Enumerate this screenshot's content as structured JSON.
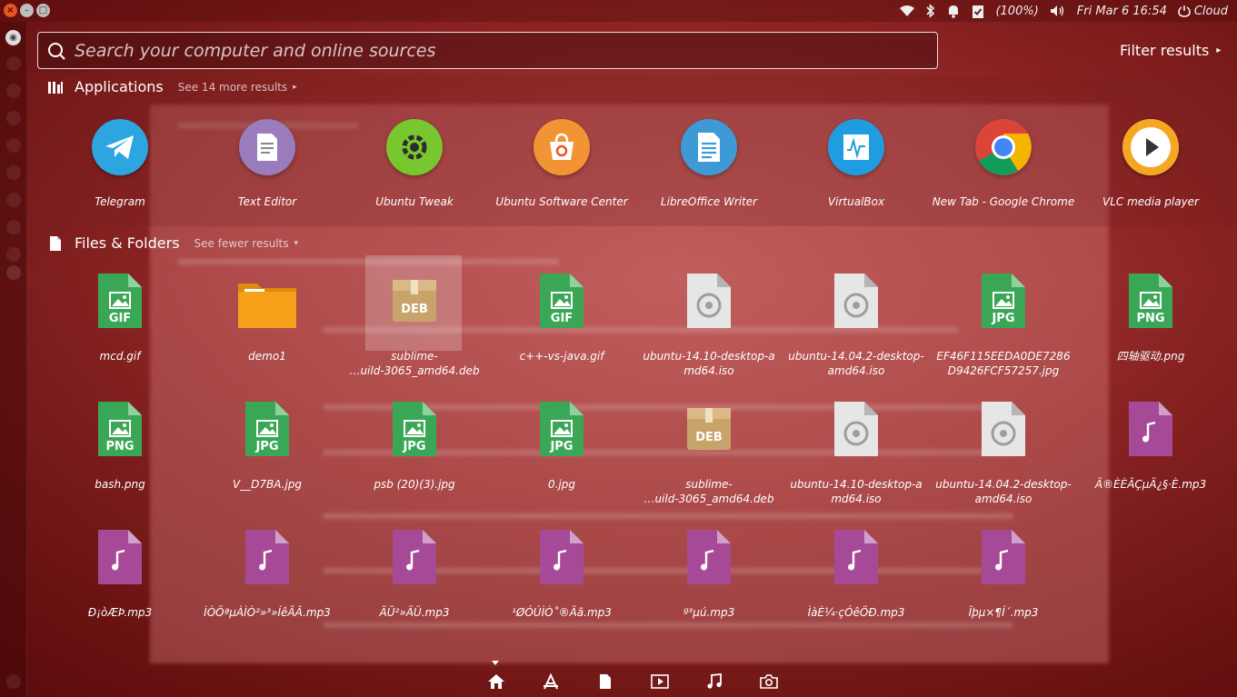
{
  "top_panel": {
    "battery": "(100%)",
    "datetime": "Fri Mar  6 16:54",
    "user": "Cloud"
  },
  "search": {
    "placeholder": "Search your computer and online sources",
    "value": ""
  },
  "filter": {
    "label": "Filter results"
  },
  "applications": {
    "title": "Applications",
    "more": "See 14 more results",
    "items": [
      {
        "label": "Telegram",
        "icon": "telegram-icon",
        "color": "#2ca5e0"
      },
      {
        "label": "Text Editor",
        "icon": "text-editor-icon",
        "color": "#9a7bbb"
      },
      {
        "label": "Ubuntu Tweak",
        "icon": "ubuntu-tweak-icon",
        "color": "#79c72f"
      },
      {
        "label": "Ubuntu Software Center",
        "icon": "software-center-icon",
        "color": "#f29434"
      },
      {
        "label": "LibreOffice Writer",
        "icon": "libreoffice-writer-icon",
        "color": "#3d9ad6"
      },
      {
        "label": "VirtualBox",
        "icon": "virtualbox-icon",
        "color": "#1f9de0"
      },
      {
        "label": "New Tab - Google Chrome",
        "icon": "chrome-icon",
        "color": "#4a8af4"
      },
      {
        "label": "VLC media player",
        "icon": "vlc-icon",
        "color": "#f5a623"
      }
    ]
  },
  "files": {
    "title": "Files & Folders",
    "more": "See fewer results",
    "items": [
      {
        "label": "mcd.gif",
        "type": "GIF",
        "kind": "image"
      },
      {
        "label": "demo1",
        "type": "",
        "kind": "folder"
      },
      {
        "label": "sublime-\n…uild-3065_amd64.deb",
        "type": "DEB",
        "kind": "deb"
      },
      {
        "label": "c++-vs-java.gif",
        "type": "GIF",
        "kind": "image"
      },
      {
        "label": "ubuntu-14.10-desktop-amd64.iso",
        "type": "",
        "kind": "iso"
      },
      {
        "label": "ubuntu-14.04.2-desktop-amd64.iso",
        "type": "",
        "kind": "iso"
      },
      {
        "label": "EF46F115EEDA0DE7286D9426FCF57257.jpg",
        "type": "JPG",
        "kind": "image"
      },
      {
        "label": "四轴驱动.png",
        "type": "PNG",
        "kind": "image"
      },
      {
        "label": "bash.png",
        "type": "PNG",
        "kind": "image"
      },
      {
        "label": "V__D7BA.jpg",
        "type": "JPG",
        "kind": "image"
      },
      {
        "label": "psb (20)(3).jpg",
        "type": "JPG",
        "kind": "image"
      },
      {
        "label": "0.jpg",
        "type": "JPG",
        "kind": "image"
      },
      {
        "label": "sublime-\n…uild-3065_amd64.deb",
        "type": "DEB",
        "kind": "deb"
      },
      {
        "label": "ubuntu-14.10-desktop-amd64.iso",
        "type": "",
        "kind": "iso"
      },
      {
        "label": "ubuntu-14.04.2-desktop-amd64.iso",
        "type": "",
        "kind": "iso"
      },
      {
        "label": "Ã®ÈÈÃÇµÄ¿§·È.mp3",
        "type": "",
        "kind": "audio"
      },
      {
        "label": "Ð¡òÆÞ.mp3",
        "type": "",
        "kind": "audio"
      },
      {
        "label": "ÌÒÖªµÀÌÒ²»³»ÍêÃÂ.mp3",
        "type": "",
        "kind": "audio"
      },
      {
        "label": "ÄÜ²»ÄÜ.mp3",
        "type": "",
        "kind": "audio"
      },
      {
        "label": "¹ØÓÚÌÒ˚®Äã.mp3",
        "type": "",
        "kind": "audio"
      },
      {
        "label": "º³µú.mp3",
        "type": "",
        "kind": "audio"
      },
      {
        "label": "ÌàÈ¼·çÓêÖÐ.mp3",
        "type": "",
        "kind": "audio"
      },
      {
        "label": "Îþµ×¶Í´.mp3",
        "type": "",
        "kind": "audio"
      }
    ]
  },
  "lenses": [
    "home-lens-icon",
    "applications-lens-icon",
    "files-lens-icon",
    "video-lens-icon",
    "music-lens-icon",
    "photos-lens-icon"
  ],
  "colors": {
    "accent": "#e95420",
    "image_file": "#3aa757",
    "audio_file": "#a64a97",
    "deb_file": "#c9a46a",
    "iso_file": "#e6e6e6",
    "folder": "#f7a11a"
  }
}
